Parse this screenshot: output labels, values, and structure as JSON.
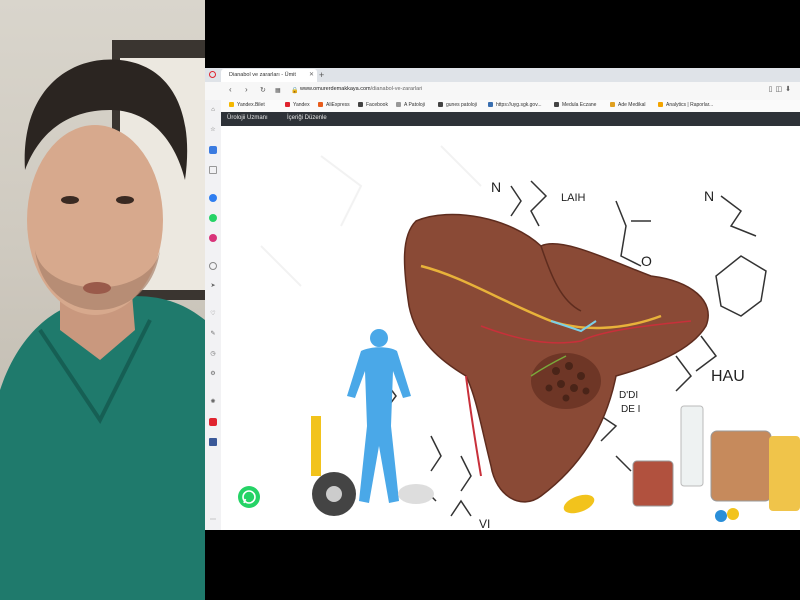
{
  "browser": {
    "tab_title": "Dianabol ve zararları - Ümit",
    "url_host": "www.omurerdemakkaya.com",
    "url_path": "/dianabol-ve-zararlari"
  },
  "bookmarks": [
    {
      "label": "Yandex.Bilet",
      "color": "#f5b800"
    },
    {
      "label": "Yandex",
      "color": "#e0242f"
    },
    {
      "label": "AliExpress",
      "color": "#e85d1c"
    },
    {
      "label": "Facebook",
      "color": "#444"
    },
    {
      "label": "A Patoloji",
      "color": "#999"
    },
    {
      "label": "gunes patoloji",
      "color": "#444"
    },
    {
      "label": "https://uyg.sgk.gov...",
      "color": "#3a6fb0"
    },
    {
      "label": "Medula Eczane",
      "color": "#444"
    },
    {
      "label": "Ade Medikal",
      "color": "#e0a020"
    },
    {
      "label": "Analytics | Raporlar...",
      "color": "#f3a400"
    }
  ],
  "site_nav": {
    "link1": "Ürolojii Uzmanı",
    "link2": "İçeriği Düzenle"
  },
  "illustration": {
    "labels": [
      "N",
      "LAIH",
      "N",
      "HAU",
      "O",
      "D'DI",
      "DE I",
      "VI"
    ]
  },
  "colors": {
    "liver": "#8a4a36",
    "liver_dark": "#6e3626",
    "figure": "#4aa8e8",
    "nav_bg": "#2e3238",
    "whatsapp": "#25d366"
  }
}
